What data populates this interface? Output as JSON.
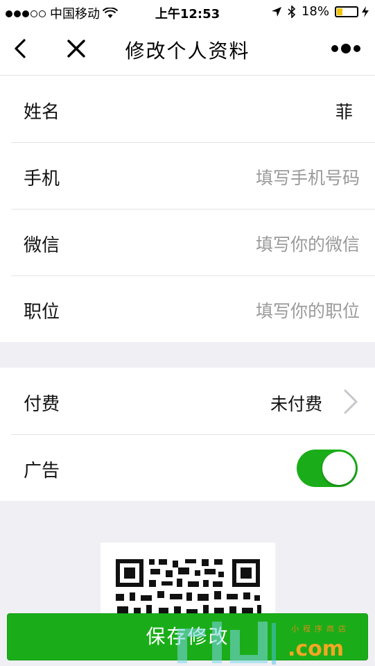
{
  "status": {
    "carrier": "中国移动",
    "time": "上午12:53",
    "battery": "18%",
    "battery_level": 0.18
  },
  "nav": {
    "title": "修改个人资料"
  },
  "profile": {
    "name_label": "姓名",
    "name_value": "菲",
    "phone_label": "手机",
    "phone_placeholder": "填写手机号码",
    "wechat_label": "微信",
    "wechat_placeholder": "填写你的微信",
    "position_label": "职位",
    "position_placeholder": "填写你的职位"
  },
  "settings": {
    "payment_label": "付费",
    "payment_value": "未付费",
    "ad_label": "广告",
    "ad_enabled": true
  },
  "actions": {
    "save_label": "保存修改"
  },
  "watermark": {
    "text": ".com",
    "small_text": "小程序商店"
  },
  "colors": {
    "accent": "#1aad19",
    "background": "#f0eff4"
  }
}
